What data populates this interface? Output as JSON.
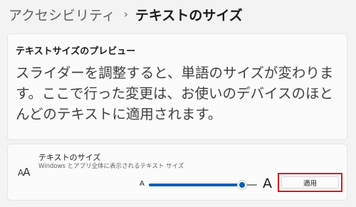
{
  "breadcrumb": {
    "parent": "アクセシビリティ",
    "separator": "›",
    "current": "テキストのサイズ"
  },
  "preview": {
    "title": "テキストサイズのプレビュー",
    "text": "スライダーを調整すると、単語のサイズが変わります。ここで行った変更は、お使いのデバイスのほとんどのテキストに適用されます。"
  },
  "text_size": {
    "icon_small": "A",
    "icon_big": "A",
    "title": "テキストのサイズ",
    "description": "Windows とアプリ全体に表示されるテキスト サイズ",
    "slider_min_label": "A",
    "slider_max_label": "A",
    "slider_value_fraction": 0.86,
    "apply_label": "適用"
  },
  "colors": {
    "accent": "#005fb8",
    "highlight": "#d9181f"
  }
}
